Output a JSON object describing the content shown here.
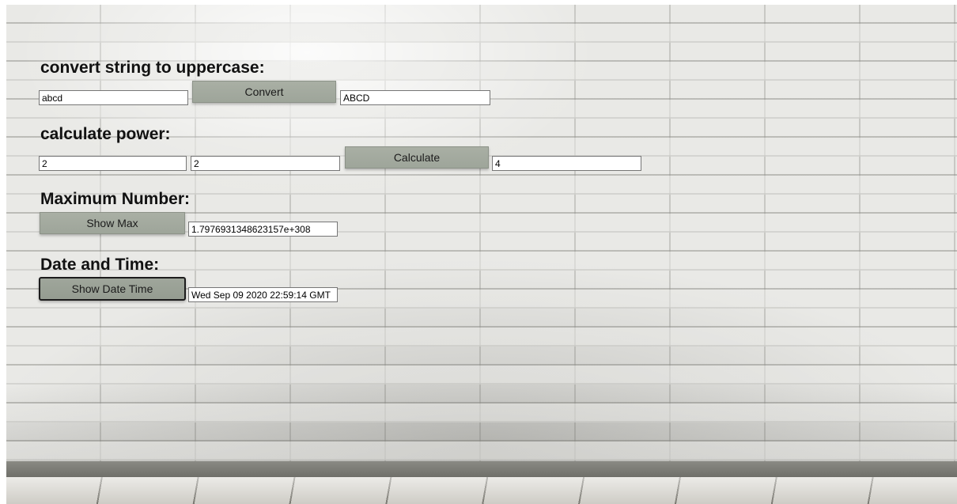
{
  "sections": [
    {
      "title": "convert string to uppercase:",
      "input_value": "abcd",
      "button_label": "Convert",
      "output_value": "ABCD"
    },
    {
      "title": "calculate power:",
      "base_value": "2",
      "exponent_value": "2",
      "button_label": "Calculate",
      "output_value": "4"
    },
    {
      "title": "Maximum Number:",
      "button_label": "Show Max",
      "output_value": "1.7976931348623157e+308"
    },
    {
      "title": "Date and Time:",
      "button_label": "Show Date Time",
      "output_value": "Wed Sep 09 2020 22:59:14 GMT"
    }
  ]
}
